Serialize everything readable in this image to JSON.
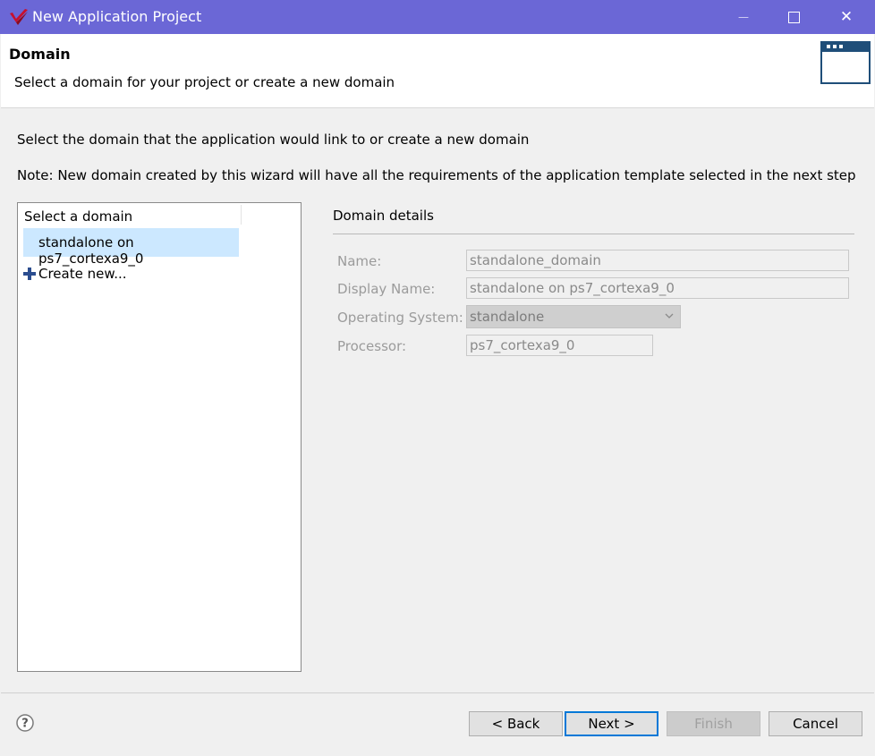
{
  "window": {
    "title": "New Application Project",
    "minimize_glyph": "—",
    "maximize_glyph": "☐",
    "close_glyph": "✕"
  },
  "header": {
    "title": "Domain",
    "subtitle": "Select a domain for your project or create a new domain"
  },
  "body": {
    "instruction": "Select the domain that the application would link to or create a new domain",
    "note": "Note: New domain created by this wizard will have all the requirements of the application template selected in the next step"
  },
  "domain_tree": {
    "header": "Select a domain",
    "items": [
      {
        "label": "standalone on ps7_cortexa9_0",
        "selected": true
      }
    ],
    "create_new": "Create new..."
  },
  "details": {
    "title": "Domain details",
    "name_label": "Name:",
    "name_value": "standalone_domain",
    "display_name_label": "Display Name:",
    "display_name_value": "standalone on ps7_cortexa9_0",
    "os_label": "Operating System:",
    "os_value": "standalone",
    "processor_label": "Processor:",
    "processor_value": "ps7_cortexa9_0"
  },
  "footer": {
    "back": "< Back",
    "next": "Next >",
    "finish": "Finish",
    "cancel": "Cancel"
  },
  "colors": {
    "titlebar": "#6b67d6",
    "selection": "#cce8ff",
    "default_button_border": "#0078d7"
  }
}
